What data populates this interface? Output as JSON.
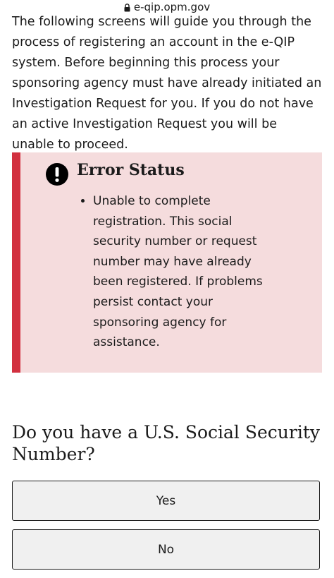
{
  "browser": {
    "url": "e-qip.opm.gov",
    "lock_icon": "lock-icon"
  },
  "intro": {
    "text": "The following screens will guide you through the process of registering an account in the e-QIP system. Before beginning this process your sponsoring agency must have already initiated an Investigation Request for you. If you do not have an active Investigation Request you will be unable to proceed."
  },
  "alert": {
    "icon": "exclamation-circle-icon",
    "heading": "Error Status",
    "messages": [
      "Unable to complete registration. This social security number or request number may have already been registered. If problems persist contact your sponsoring agency for assistance."
    ],
    "background_color": "#f5dcdd",
    "border_color": "#d2303f"
  },
  "question": {
    "text": "Do you have a U.S. Social Security Number?",
    "options": [
      {
        "label": "Yes"
      },
      {
        "label": "No"
      }
    ]
  }
}
